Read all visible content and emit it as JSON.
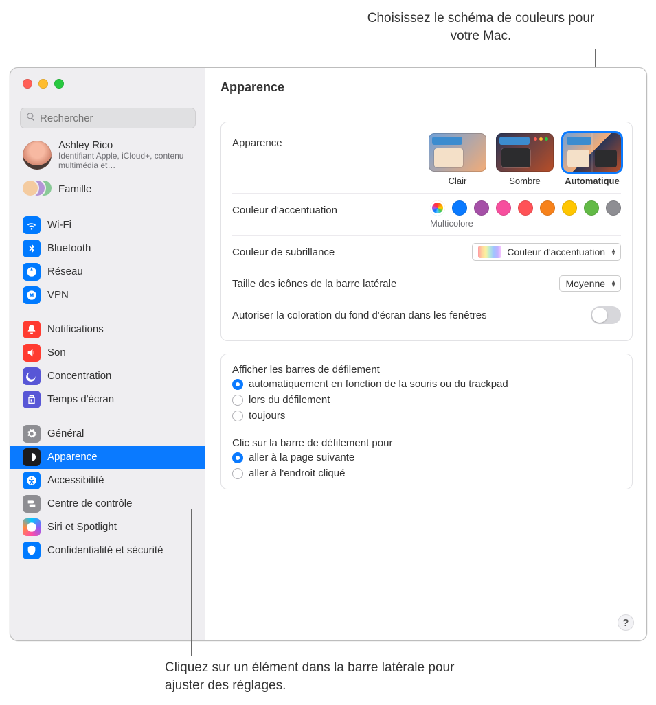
{
  "callouts": {
    "top": "Choisissez le schéma de couleurs pour votre Mac.",
    "bottom": "Cliquez sur un élément dans la barre latérale pour ajuster des réglages."
  },
  "window": {
    "title": "Apparence",
    "search_placeholder": "Rechercher"
  },
  "user": {
    "name": "Ashley Rico",
    "subtitle": "Identifiant Apple, iCloud+, contenu multimédia et…"
  },
  "family_label": "Famille",
  "sidebar": {
    "groups": [
      {
        "items": [
          {
            "id": "wifi",
            "label": "Wi-Fi",
            "color": "#007aff"
          },
          {
            "id": "bluetooth",
            "label": "Bluetooth",
            "color": "#007aff"
          },
          {
            "id": "network",
            "label": "Réseau",
            "color": "#007aff"
          },
          {
            "id": "vpn",
            "label": "VPN",
            "color": "#007aff"
          }
        ]
      },
      {
        "items": [
          {
            "id": "notifications",
            "label": "Notifications",
            "color": "#ff3b30"
          },
          {
            "id": "sound",
            "label": "Son",
            "color": "#ff3b30"
          },
          {
            "id": "focus",
            "label": "Concentration",
            "color": "#5856d6"
          },
          {
            "id": "screentime",
            "label": "Temps d'écran",
            "color": "#5856d6"
          }
        ]
      },
      {
        "items": [
          {
            "id": "general",
            "label": "Général",
            "color": "#8e8e93"
          },
          {
            "id": "appearance",
            "label": "Apparence",
            "color": "#1c1c1e",
            "selected": true
          },
          {
            "id": "accessibility",
            "label": "Accessibilité",
            "color": "#007aff"
          },
          {
            "id": "controlcenter",
            "label": "Centre de contrôle",
            "color": "#8e8e93"
          },
          {
            "id": "siri",
            "label": "Siri et Spotlight",
            "color": "#000000"
          },
          {
            "id": "privacy",
            "label": "Confidentialité et sécurité",
            "color": "#007aff"
          }
        ]
      }
    ]
  },
  "content": {
    "appearance_label": "Apparence",
    "themes": [
      {
        "id": "light",
        "label": "Clair"
      },
      {
        "id": "dark",
        "label": "Sombre"
      },
      {
        "id": "auto",
        "label": "Automatique",
        "selected": true
      }
    ],
    "accent_label": "Couleur d'accentuation",
    "accent_selected_name": "Multicolore",
    "accent_colors": [
      "multi",
      "#0a7aff",
      "#a550a7",
      "#f74f9e",
      "#ff5257",
      "#f7821b",
      "#ffc600",
      "#62ba46",
      "#8e8e93"
    ],
    "highlight_label": "Couleur de subrillance",
    "highlight_value": "Couleur d'accentuation",
    "sidebar_icon_label": "Taille des icônes de la barre latérale",
    "sidebar_icon_value": "Moyenne",
    "wallpaper_tint_label": "Autoriser la coloration du fond d'écran dans les fenêtres",
    "wallpaper_tint_on": false,
    "scrollbars": {
      "heading": "Afficher les barres de défilement",
      "options": [
        {
          "label": "automatiquement en fonction de la souris ou du trackpad",
          "checked": true
        },
        {
          "label": "lors du défilement",
          "checked": false
        },
        {
          "label": "toujours",
          "checked": false
        }
      ]
    },
    "scrollclick": {
      "heading": "Clic sur la barre de défilement pour",
      "options": [
        {
          "label": "aller à la page suivante",
          "checked": true
        },
        {
          "label": "aller à l'endroit cliqué",
          "checked": false
        }
      ]
    }
  },
  "help_label": "?"
}
